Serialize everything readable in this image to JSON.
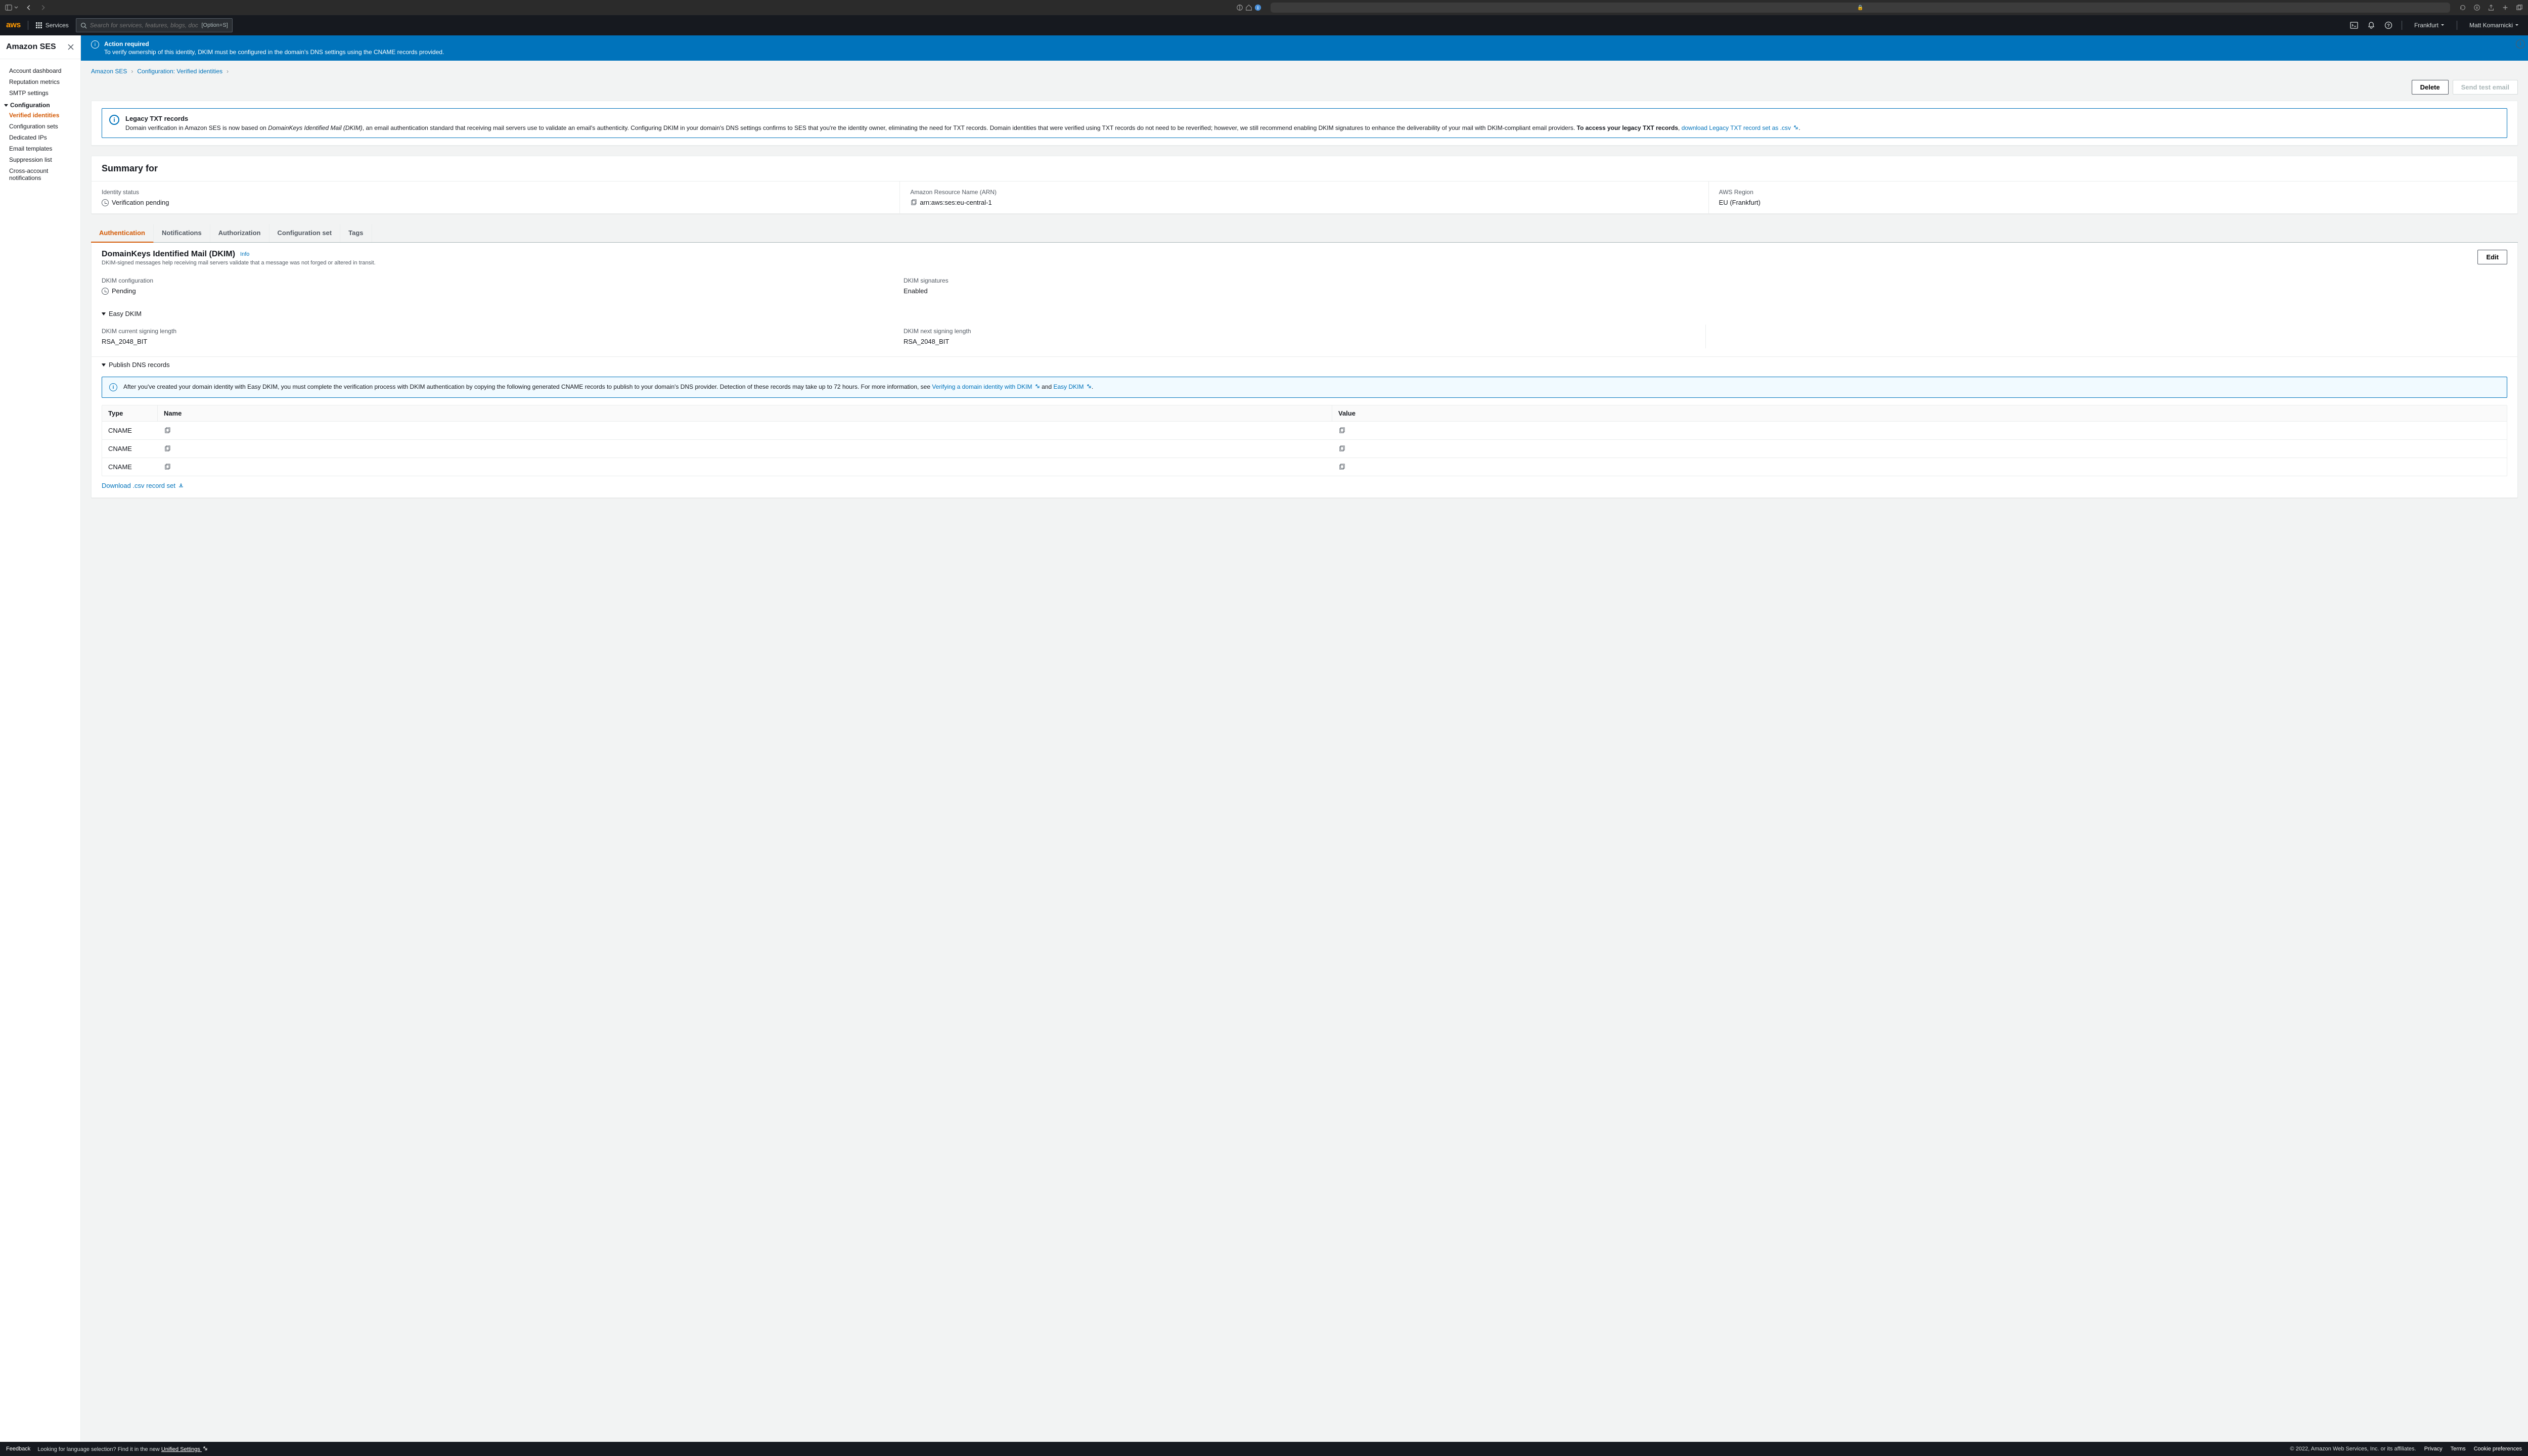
{
  "browser": {
    "lock": "🔒"
  },
  "awsnav": {
    "logo": "aws",
    "services": "Services",
    "search_placeholder": "Search for services, features, blogs, docs, and more",
    "shortcut": "[Option+S]",
    "region": "Frankfurt",
    "user": "Matt Komarnicki"
  },
  "sidebar": {
    "title": "Amazon SES",
    "links": {
      "dashboard": "Account dashboard",
      "reputation": "Reputation metrics",
      "smtp": "SMTP settings",
      "config": "Configuration",
      "verified": "Verified identities",
      "configsets": "Configuration sets",
      "dedips": "Dedicated IPs",
      "templates": "Email templates",
      "suppression": "Suppression list",
      "crossacct": "Cross-account notifications"
    }
  },
  "flash": {
    "title": "Action required",
    "body": "To verify ownership of this identity, DKIM must be configured in the domain's DNS settings using the CNAME records provided."
  },
  "breadcrumbs": {
    "a": "Amazon SES",
    "b": "Configuration: Verified identities"
  },
  "actions": {
    "delete": "Delete",
    "sendtest": "Send test email"
  },
  "legacy": {
    "title": "Legacy TXT records",
    "b1a": "Domain verification in Amazon SES is now based on ",
    "b1b": "DomainKeys Identified Mail (DKIM)",
    "b1c": ", an email authentication standard that receiving mail servers use to validate an email's authenticity. Configuring DKIM in your domain's DNS settings confirms to SES that you're the identity owner, eliminating the need for TXT records. Domain identities that were verified using TXT records do not need to be reverified; however, we still recommend enabling DKIM signatures to enhance the deliverability of your mail with DKIM-compliant email providers. ",
    "b1d": "To access your legacy TXT records",
    "b1e": ", ",
    "link": "download Legacy TXT record set as .csv"
  },
  "summary": {
    "title": "Summary for",
    "identity_label": "Identity status",
    "identity_value": "Verification pending",
    "arn_label": "Amazon Resource Name (ARN)",
    "arn_value": "arn:aws:ses:eu-central-1",
    "region_label": "AWS Region",
    "region_value": "EU (Frankfurt)"
  },
  "tabs": {
    "auth": "Authentication",
    "notif": "Notifications",
    "authorization": "Authorization",
    "configset": "Configuration set",
    "tags": "Tags"
  },
  "dkim": {
    "title": "DomainKeys Identified Mail (DKIM)",
    "info": "Info",
    "desc": "DKIM-signed messages help receiving mail servers validate that a message was not forged or altered in transit.",
    "edit": "Edit",
    "config_label": "DKIM configuration",
    "config_value": "Pending",
    "sig_label": "DKIM signatures",
    "sig_value": "Enabled",
    "easy": "Easy DKIM",
    "curlen_label": "DKIM current signing length",
    "curlen_value": "RSA_2048_BIT",
    "nextlen_label": "DKIM next signing length",
    "nextlen_value": "RSA_2048_BIT",
    "publish": "Publish DNS records",
    "note_a": "After you've created your domain identity with Easy DKIM, you must complete the verification process with DKIM authentication by copying the following generated CNAME records to publish to your domain's DNS provider. Detection of these records may take up to 72 hours. For more information, see ",
    "note_link1": "Verifying a domain identity with DKIM",
    "note_and": " and ",
    "note_link2": "Easy DKIM",
    "note_end": "."
  },
  "dns": {
    "h_type": "Type",
    "h_name": "Name",
    "h_value": "Value",
    "rows": [
      {
        "type": "CNAME"
      },
      {
        "type": "CNAME"
      },
      {
        "type": "CNAME"
      }
    ],
    "download": "Download .csv record set"
  },
  "footer": {
    "feedback": "Feedback",
    "lang_a": "Looking for language selection? Find it in the new ",
    "lang_b": "Unified Settings",
    "copyright": "© 2022, Amazon Web Services, Inc. or its affiliates.",
    "privacy": "Privacy",
    "terms": "Terms",
    "cookies": "Cookie preferences"
  }
}
